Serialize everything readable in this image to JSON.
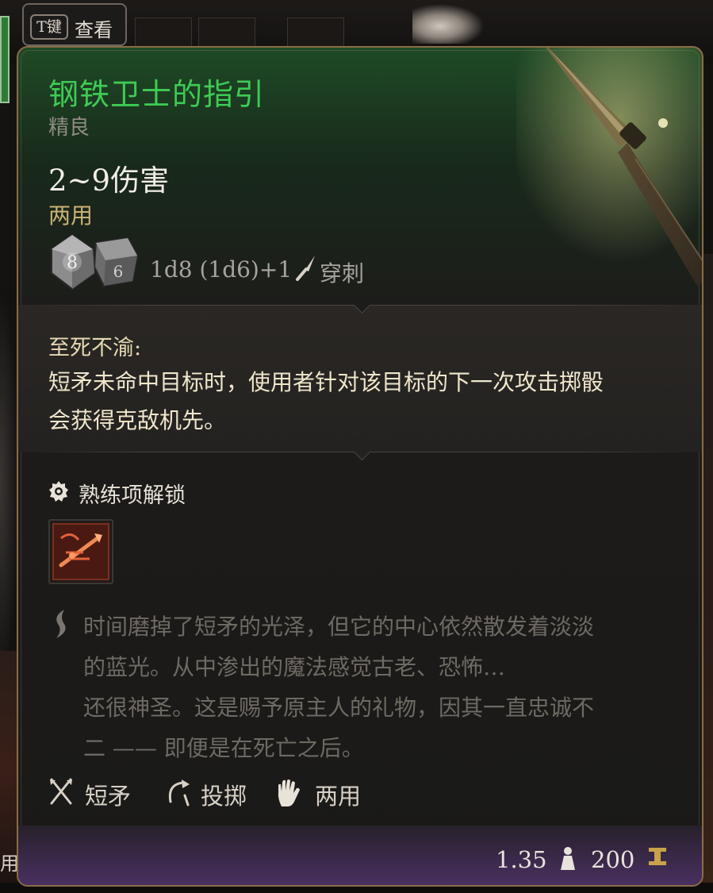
{
  "background_ui": {
    "hotkey": "T键",
    "hotkey_action": "查看",
    "left_edge_label": "用"
  },
  "item": {
    "name": "钢铁卫士的指引",
    "rarity": "精良",
    "damage": "2~9伤害",
    "handedness": "两用",
    "dice": [
      "8",
      "6"
    ],
    "damage_formula": "1d8 (1d6)+1",
    "damage_type": "穿刺",
    "name_color": "#3ecb54"
  },
  "passive": {
    "title": "至死不渝:",
    "description": "短矛未命中目标时，使用者针对该目标的下一次攻击掷骰会获得克敌机先。"
  },
  "proficiency": {
    "title": "熟练项解锁",
    "skill_icon": "pierce-skill-icon"
  },
  "lore": {
    "lines": [
      "时间磨掉了短矛的光泽，但它的中心依然散发着淡淡",
      "的蓝光。从中渗出的魔法感觉古老、恐怖…",
      "还很神圣。这是赐予原主人的礼物，因其一直忠诚不",
      "二 —— 即便是在死亡之后。"
    ]
  },
  "tags": [
    {
      "label": "短矛",
      "icon": "crossed-spears-icon"
    },
    {
      "label": "投掷",
      "icon": "throw-icon"
    },
    {
      "label": "两用",
      "icon": "hand-icon"
    }
  ],
  "footer": {
    "weight": "1.35",
    "price": "200"
  }
}
